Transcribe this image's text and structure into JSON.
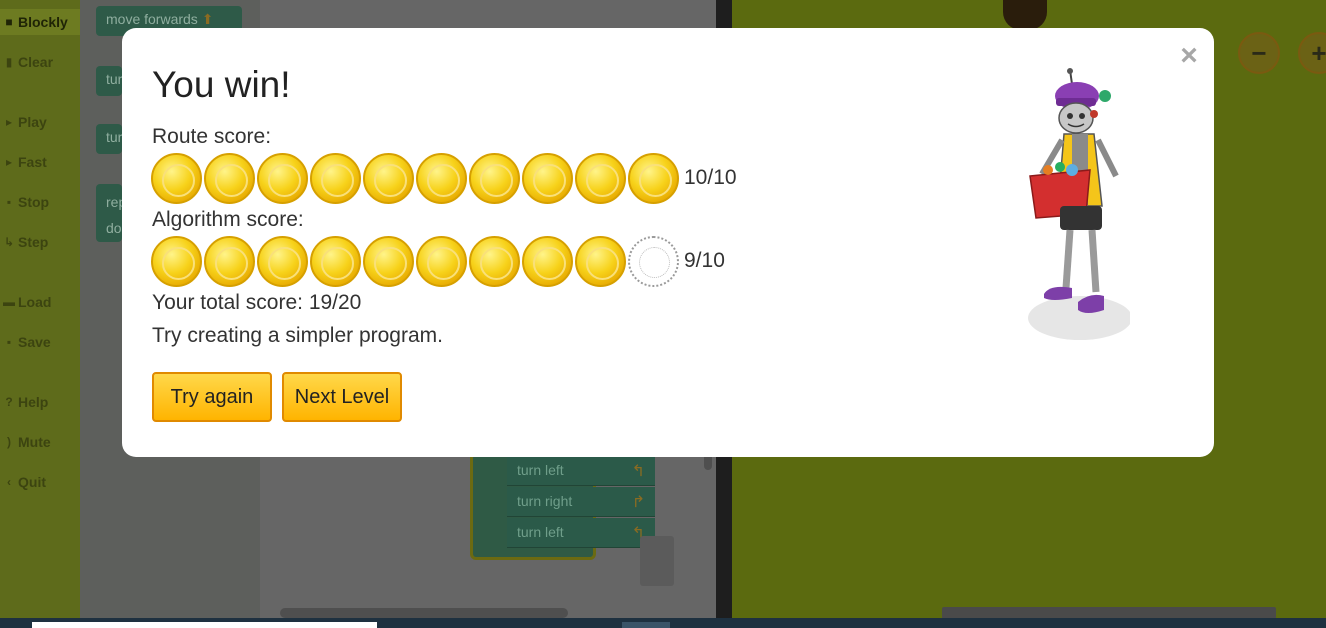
{
  "sidebar": {
    "items": [
      {
        "label": "Blockly",
        "icon": "puzzle-icon",
        "active": true
      },
      {
        "label": "Clear",
        "icon": "trash-icon"
      },
      {
        "label": "Play",
        "icon": "play-icon"
      },
      {
        "label": "Fast",
        "icon": "fast-forward-icon"
      },
      {
        "label": "Stop",
        "icon": "stop-icon"
      },
      {
        "label": "Step",
        "icon": "step-icon"
      },
      {
        "label": "Load",
        "icon": "folder-icon"
      },
      {
        "label": "Save",
        "icon": "save-icon"
      },
      {
        "label": "Help",
        "icon": "help-icon"
      },
      {
        "label": "Mute",
        "icon": "speaker-icon"
      },
      {
        "label": "Quit",
        "icon": "quit-icon"
      }
    ]
  },
  "toolbox": {
    "blocks": [
      "move forwards",
      "tur",
      "tur",
      "rep",
      "do"
    ]
  },
  "workspace": {
    "blocks": [
      "turn left",
      "turn right",
      "turn left"
    ]
  },
  "modal": {
    "title": "You win!",
    "route_label": "Route score:",
    "route_score": "10/10",
    "route_coins_earned": 10,
    "route_coins_total": 10,
    "algorithm_label": "Algorithm score:",
    "algorithm_score": "9/10",
    "algorithm_coins_earned": 9,
    "algorithm_coins_total": 10,
    "total_score": "Your total score: 19/20",
    "hint": "Try creating a simpler program.",
    "try_again_label": "Try again",
    "next_level_label": "Next Level",
    "close_symbol": "×"
  },
  "game": {
    "zoom_out_symbol": "−",
    "zoom_in_symbol": "+"
  },
  "colors": {
    "coin_gold": "#f7d21a",
    "button_yellow": "#ffc21a",
    "button_border": "#e08a00",
    "overlay_green": "#6f7d1e"
  }
}
